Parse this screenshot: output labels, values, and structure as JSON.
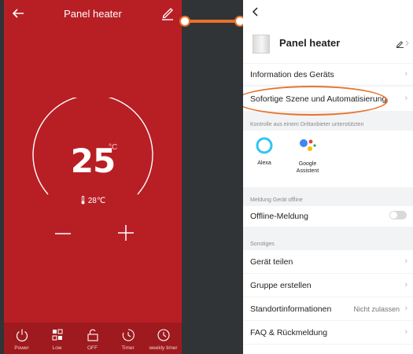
{
  "left_app": {
    "title": "Panel heater",
    "set_temp": "25",
    "set_unit": "°C",
    "room_temp": "28℃",
    "tabs": [
      {
        "label": "Power",
        "icon": "power-icon"
      },
      {
        "label": "Low",
        "icon": "mode-icon"
      },
      {
        "label": "OFF",
        "icon": "lock-icon"
      },
      {
        "label": "Timer",
        "icon": "timer-icon"
      },
      {
        "label": "weekly timer",
        "icon": "weekly-timer-icon"
      }
    ],
    "colors": {
      "background": "#b81f24",
      "bottom_bar": "#9e1a1e"
    }
  },
  "right_app": {
    "device_name": "Panel heater",
    "items": {
      "info": "Information des Geräts",
      "scene": "Sofortige Szene und Automatisierung"
    },
    "third_party_header": "Kontrolle aus einem Drittanbieter unterstützten",
    "services": [
      "Alexa",
      "Google Assistent"
    ],
    "offline_header": "Meldung Gerät offline",
    "offline_label": "Offline-Meldung",
    "other_header": "Sonstiges",
    "other_items": {
      "share": "Gerät teilen",
      "group": "Gruppe erstellen",
      "location": "Standortinformationen",
      "location_value": "Nicht zulassen",
      "faq": "FAQ & Rückmeldung"
    },
    "colors": {
      "highlight": "#e8722b"
    }
  }
}
